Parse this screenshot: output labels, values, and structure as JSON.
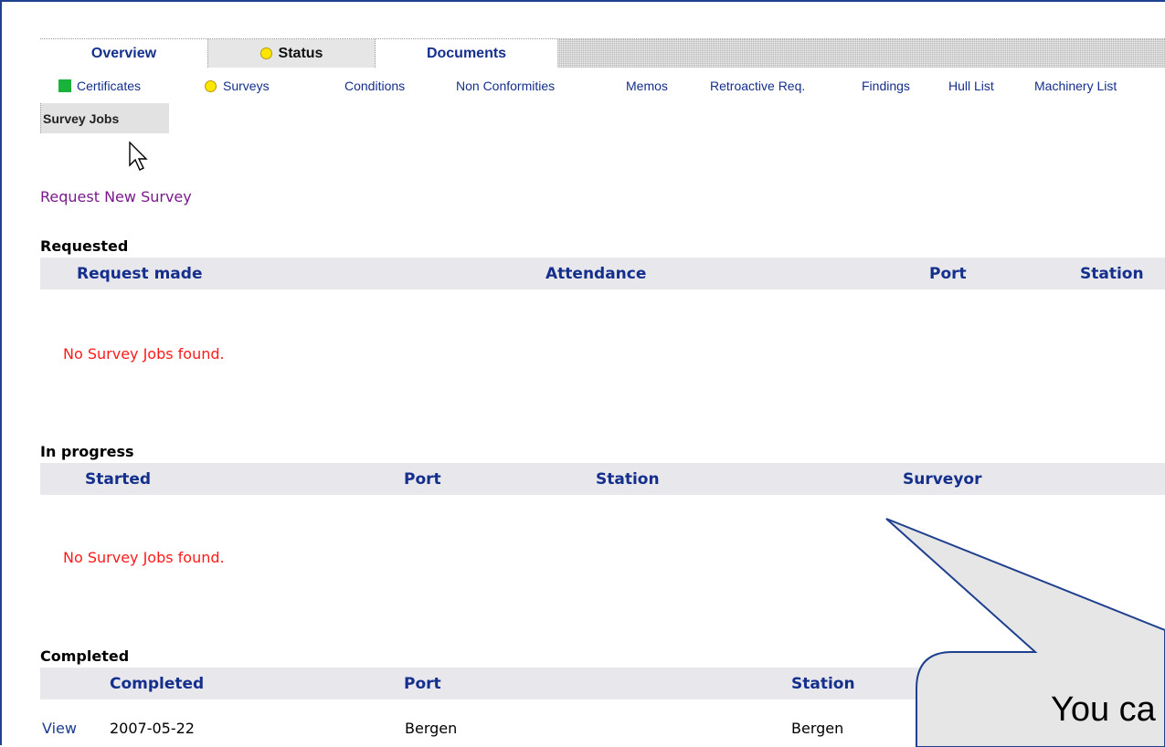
{
  "tabs": [
    {
      "label": "Overview"
    },
    {
      "label": "Status",
      "status_dot": "yellow"
    },
    {
      "label": "Documents"
    }
  ],
  "subnav": [
    {
      "label": "Certificates",
      "status_square": "green"
    },
    {
      "label": "Surveys",
      "status_dot": "yellow"
    },
    {
      "label": "Conditions"
    },
    {
      "label": "Non Conformities"
    },
    {
      "label": "Memos"
    },
    {
      "label": "Retroactive Req."
    },
    {
      "label": "Findings"
    },
    {
      "label": "Hull List"
    },
    {
      "label": "Machinery List"
    }
  ],
  "active_subtab": "Survey Jobs",
  "request_link": "Request New Survey",
  "requested": {
    "title": "Requested",
    "columns": [
      "Request made",
      "Attendance",
      "Port",
      "Station"
    ],
    "empty_text": "No Survey Jobs found."
  },
  "in_progress": {
    "title": "In progress",
    "columns": [
      "Started",
      "Port",
      "Station",
      "Surveyor"
    ],
    "empty_text": "No Survey Jobs found."
  },
  "completed": {
    "title": "Completed",
    "columns": [
      "Completed",
      "Port",
      "Station"
    ],
    "rows": [
      {
        "action": "View",
        "completed": "2007-05-22",
        "port": "Bergen",
        "station": "Bergen"
      }
    ]
  },
  "callout": {
    "text": "You ca"
  },
  "colors": {
    "link_blue": "#142f8c",
    "error_red": "#ff1a1a",
    "request_link_purple": "#7a1a8c",
    "status_yellow": "#ffe600",
    "status_green": "#19b23b",
    "callout_fill": "#e6e6e6"
  }
}
